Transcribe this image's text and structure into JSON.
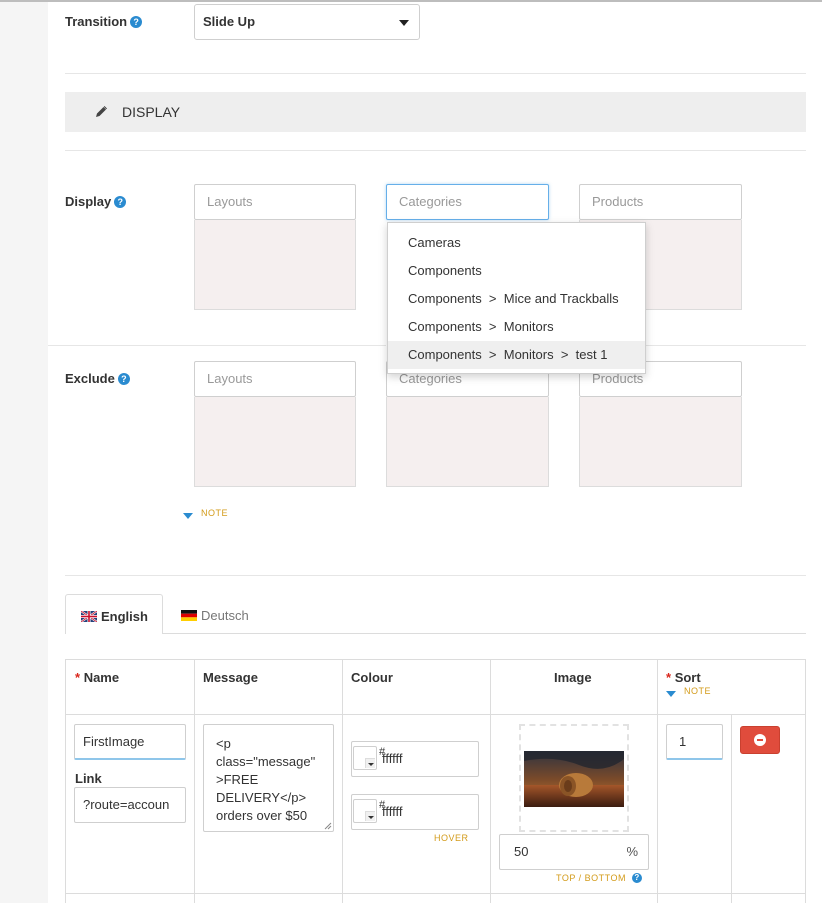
{
  "transition": {
    "label": "Transition",
    "help": "?",
    "value": "Slide Up"
  },
  "display_section": {
    "title": "DISPLAY",
    "icon": "pencil-icon"
  },
  "display": {
    "label": "Display",
    "help": "?",
    "layouts_placeholder": "Layouts",
    "categories_placeholder": "Categories",
    "products_placeholder": "Products"
  },
  "dropdown": {
    "items": [
      "Cameras",
      "Components",
      "Components  >  Mice and Trackballs",
      "Components  >  Monitors",
      "Components  >  Monitors  >  test 1"
    ]
  },
  "exclude": {
    "label": "Exclude",
    "help": "?",
    "layouts_placeholder": "Layouts",
    "categories_placeholder": "Categories",
    "products_placeholder": "Products"
  },
  "note_label": "NOTE",
  "tabs": [
    {
      "label": "English",
      "flag": "uk-flag-icon"
    },
    {
      "label": "Deutsch",
      "flag": "de-flag-icon"
    }
  ],
  "table": {
    "headers": {
      "name": "Name",
      "message": "Message",
      "colour": "Colour",
      "image": "Image",
      "sort": "Sort",
      "sort_note": "NOTE"
    },
    "row": {
      "name_value": "FirstImage",
      "link_label": "Link",
      "link_value": "?route=accoun",
      "message_value": "<p\nclass=\"message\"\n>FREE\nDELIVERY</p>\norders over $50",
      "colour_hash": "#",
      "colour_value": "ffffff",
      "hover_hash": "#",
      "hover_value": "ffffff",
      "hover_label": "HOVER",
      "image_position_value": "50",
      "image_position_unit": "%",
      "image_position_label": "TOP / BOTTOM",
      "sort_value": "1"
    }
  },
  "colors": {
    "accent_blue": "#2a8bd0",
    "required_red": "#d9261c",
    "note_orange": "#d39b1a",
    "remove_button": "#e04c3c"
  }
}
